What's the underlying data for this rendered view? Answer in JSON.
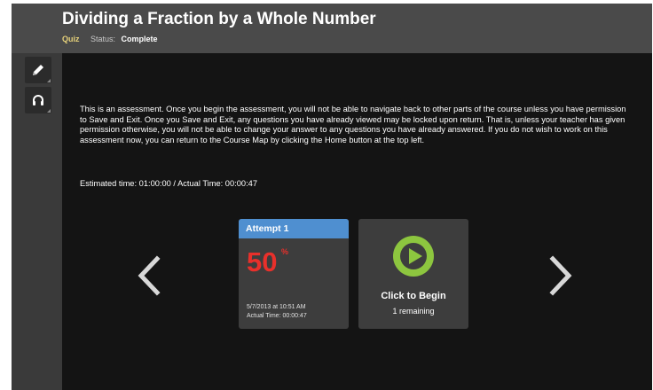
{
  "header": {
    "title": "Dividing a Fraction by a Whole Number",
    "type_label": "Quiz",
    "status_label": "Status:",
    "status_value": "Complete"
  },
  "sidebar": {
    "tools": [
      {
        "icon": "pencil-icon"
      },
      {
        "icon": "headphones-icon"
      }
    ]
  },
  "main": {
    "intro": "This is an assessment. Once you begin the assessment, you will not be able to navigate back to other parts of the course unless you have permission to Save and Exit. Once you Save and Exit, any questions you have already viewed may be locked upon return. That is, unless your teacher has given permission otherwise, you will not be able to change your answer to any questions you have already answered. If you do not wish to work on this assessment now, you can return to the Course Map by clicking the Home button at the top left.",
    "estimated_time": "Estimated time: 01:00:00 / Actual Time: 00:00:47",
    "attempt": {
      "title": "Attempt 1",
      "score": "50",
      "score_unit": "%",
      "date": "5/7/2013 at 10:51 AM",
      "actual_time": "Actual Time: 00:00:47"
    },
    "begin": {
      "label": "Click to Begin",
      "remaining": "1 remaining"
    }
  },
  "colors": {
    "header_bg": "#4a4a4a",
    "content_bg": "#141414",
    "attempt_header": "#4f8fd0",
    "score": "#e8302b",
    "play_button": "#8dc63f",
    "quiz_label": "#e6d17a"
  }
}
